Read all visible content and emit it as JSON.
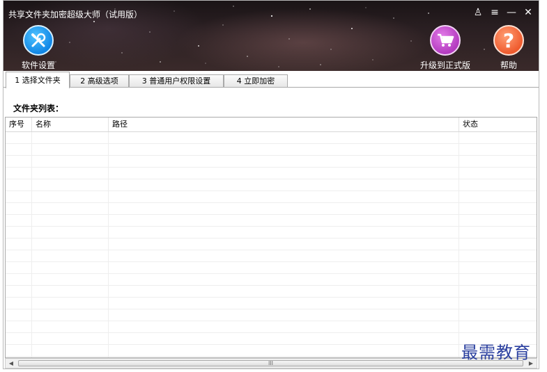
{
  "window": {
    "title": "共享文件夹加密超级大师（试用版）",
    "controls": [
      {
        "name": "skin-icon",
        "glyph": "♙"
      },
      {
        "name": "menu-icon",
        "glyph": "≡"
      },
      {
        "name": "minimize-icon",
        "glyph": "—"
      },
      {
        "name": "close-icon",
        "glyph": "✕"
      }
    ]
  },
  "toolbar": {
    "settings_label": "软件设置",
    "upgrade_label": "升级到正式版",
    "help_label": "帮助",
    "help_glyph": "?"
  },
  "tabs": [
    {
      "label": "1 选择文件夹",
      "active": true
    },
    {
      "label": "2 高级选项",
      "active": false
    },
    {
      "label": "3 普通用户权限设置",
      "active": false
    },
    {
      "label": "4 立即加密",
      "active": false
    }
  ],
  "folder_list": {
    "label": "文件夹列表：",
    "columns": [
      "序号",
      "名称",
      "路径",
      "状态"
    ]
  },
  "scrollbar": {
    "grip": "III"
  },
  "watermark": "最需教育",
  "colors": {
    "settings_accent": "#1187e6",
    "upgrade_accent": "#b33bbf",
    "help_accent": "#ef5b2e",
    "watermark": "#2a3f9f"
  }
}
